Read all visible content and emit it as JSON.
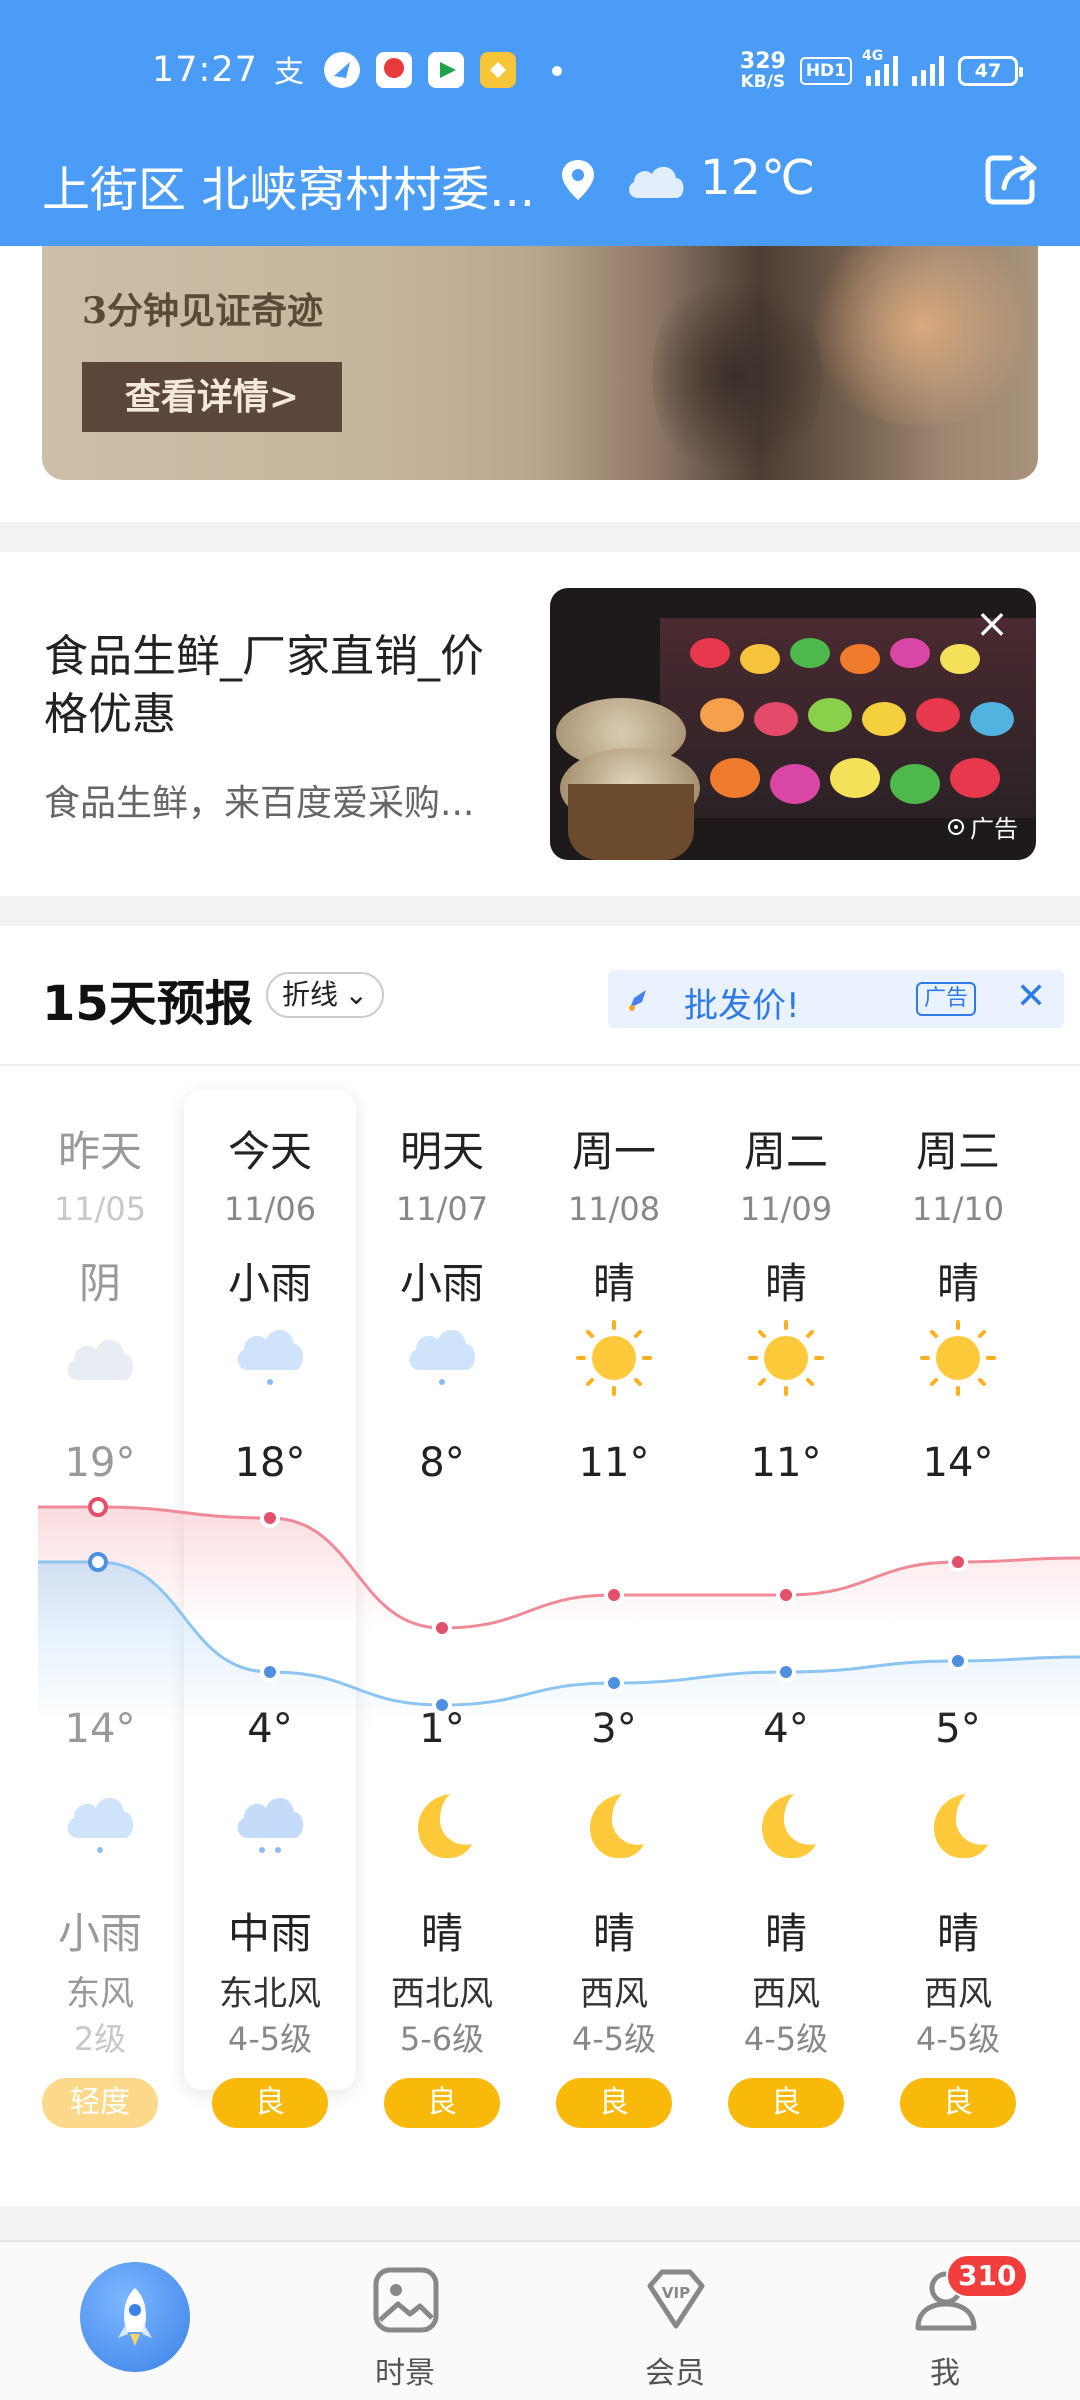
{
  "status_bar": {
    "time": "17:27",
    "net_speed_value": "329",
    "net_speed_unit": "KB/S",
    "hd_badge": "HD1",
    "signal_type": "4G",
    "battery": "47"
  },
  "header": {
    "location": "上街区 北峡窝村村委...",
    "temperature": "12℃",
    "weather_icon": "cloud-icon"
  },
  "banner_ad": {
    "subtitle": "3分钟见证奇迹",
    "button": "查看详情>"
  },
  "feed_ad": {
    "title": "食品生鲜_厂家直销_价格优惠",
    "description": "食品生鲜，来百度爱采购...",
    "label": "广告"
  },
  "forecast": {
    "title": "15天预报",
    "toggle_label": "折线",
    "mini_ad_text": "批发价!",
    "mini_ad_label": "广告",
    "days": [
      {
        "name": "昨天",
        "date": "11/05",
        "day_cond": "阴",
        "day_icon": "cloudy-icon",
        "high": "19°",
        "low": "14°",
        "night_icon": "light-rain-icon",
        "night_cond": "小雨",
        "wind_dir": "东风",
        "wind_level": "2级",
        "aqi": "轻度",
        "past": true
      },
      {
        "name": "今天",
        "date": "11/06",
        "day_cond": "小雨",
        "day_icon": "light-rain-icon",
        "high": "18°",
        "low": "4°",
        "night_icon": "moderate-rain-icon",
        "night_cond": "中雨",
        "wind_dir": "东北风",
        "wind_level": "4-5级",
        "aqi": "良",
        "past": false
      },
      {
        "name": "明天",
        "date": "11/07",
        "day_cond": "小雨",
        "day_icon": "light-rain-icon",
        "high": "8°",
        "low": "1°",
        "night_icon": "moon-icon",
        "night_cond": "晴",
        "wind_dir": "西北风",
        "wind_level": "5-6级",
        "aqi": "良",
        "past": false
      },
      {
        "name": "周一",
        "date": "11/08",
        "day_cond": "晴",
        "day_icon": "sun-icon",
        "high": "11°",
        "low": "3°",
        "night_icon": "moon-icon",
        "night_cond": "晴",
        "wind_dir": "西风",
        "wind_level": "4-5级",
        "aqi": "良",
        "past": false
      },
      {
        "name": "周二",
        "date": "11/09",
        "day_cond": "晴",
        "day_icon": "sun-icon",
        "high": "11°",
        "low": "4°",
        "night_icon": "moon-icon",
        "night_cond": "晴",
        "wind_dir": "西风",
        "wind_level": "4-5级",
        "aqi": "良",
        "past": false
      },
      {
        "name": "周三",
        "date": "11/10",
        "day_cond": "晴",
        "day_icon": "sun-icon",
        "high": "14°",
        "low": "5°",
        "night_icon": "moon-icon",
        "night_cond": "晴",
        "wind_dir": "西风",
        "wind_level": "4-5级",
        "aqi": "良",
        "past": false
      }
    ],
    "colors": {
      "high_line": "#f08a96",
      "low_line": "#8cc4f2",
      "aqi_good": "#f9b90b",
      "aqi_light": "#fcd98a"
    }
  },
  "bottom_nav": {
    "items": [
      {
        "label": "",
        "icon": "rocket-icon"
      },
      {
        "label": "时景",
        "icon": "image-icon"
      },
      {
        "label": "会员",
        "icon": "vip-icon"
      },
      {
        "label": "我",
        "icon": "profile-icon"
      }
    ],
    "badge": "310"
  }
}
